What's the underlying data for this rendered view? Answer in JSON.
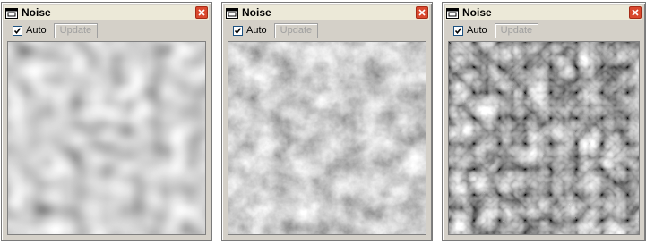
{
  "windows": [
    {
      "title": "Noise",
      "auto_label": "Auto",
      "auto_checked": true,
      "update_label": "Update",
      "preview": {
        "style": "smooth",
        "base_frequency": "0.045",
        "octaves": 1
      }
    },
    {
      "title": "Noise",
      "auto_label": "Auto",
      "auto_checked": true,
      "update_label": "Update",
      "preview": {
        "style": "fractal",
        "base_frequency": "0.04",
        "octaves": 5
      }
    },
    {
      "title": "Noise",
      "auto_label": "Auto",
      "auto_checked": true,
      "update_label": "Update",
      "preview": {
        "style": "turbulence",
        "base_frequency": "0.035",
        "octaves": 3
      }
    }
  ],
  "colors": {
    "window_bg": "#d4d0c8",
    "close_button": "#d9492e",
    "title_text": "#000000",
    "disabled_text": "#a0a0a0"
  },
  "icons": [
    "app-window-icon",
    "close-icon",
    "checkmark-icon"
  ]
}
